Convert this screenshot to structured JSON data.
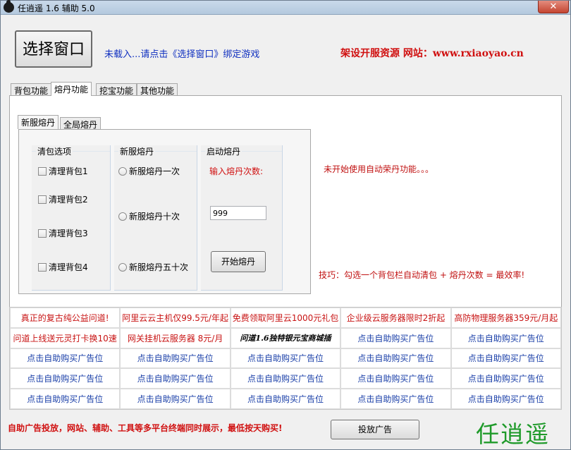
{
  "window": {
    "title": "任逍遥 1.6 辅助 5.0",
    "close_label": "✕"
  },
  "header": {
    "select_window_label": "选择窗口",
    "status_text": "未载入...请点击《选择窗口》绑定游戏",
    "site_text": "架设开服资源 网站：www.rxiaoyao.cn"
  },
  "tabs": [
    {
      "label": "背包功能"
    },
    {
      "label": "熔丹功能"
    },
    {
      "label": "挖宝功能"
    },
    {
      "label": "其他功能"
    }
  ],
  "sub_tabs": [
    {
      "label": "新服熔丹"
    },
    {
      "label": "全局熔丹"
    }
  ],
  "clean_bag": {
    "title": "清包选项",
    "items": [
      {
        "label": "清理背包1",
        "checked": false
      },
      {
        "label": "清理背包2",
        "checked": false
      },
      {
        "label": "清理背包3",
        "checked": false
      },
      {
        "label": "清理背包4",
        "checked": false
      }
    ]
  },
  "new_server_melt": {
    "title": "新服熔丹",
    "options": [
      {
        "label": "新服熔丹一次"
      },
      {
        "label": "新服熔丹十次"
      },
      {
        "label": "新服熔丹五十次"
      }
    ]
  },
  "start_melt": {
    "title": "启动熔丹",
    "count_label": "输入熔丹次数:",
    "count_value": "999",
    "start_button": "开始熔丹"
  },
  "notes": {
    "status": "未开始使用自动荣丹功能。。。",
    "tip": "技巧：勾选一个背包栏自动清包 + 熔丹次数 = 最效率!"
  },
  "ads": [
    {
      "text": "真正的复古纯公益问道!",
      "style": "red"
    },
    {
      "text": "阿里云云主机仅99.5元/年起",
      "style": "red"
    },
    {
      "text": "免费领取阿里云1000元礼包",
      "style": "red"
    },
    {
      "text": "企业级云服务器限时2折起",
      "style": "red"
    },
    {
      "text": "高防物理服务器359元/月起",
      "style": "red"
    },
    {
      "text": "问道上线送元灵打卡换10速",
      "style": "red"
    },
    {
      "text": "网关挂机云服务器 8元/月",
      "style": "red"
    },
    {
      "text": "问道1.6独特银元宝商城插",
      "style": "black-italic"
    },
    {
      "text": "点击自助购买广告位",
      "style": "blue"
    },
    {
      "text": "点击自助购买广告位",
      "style": "blue"
    },
    {
      "text": "点击自助购买广告位",
      "style": "blue"
    },
    {
      "text": "点击自助购买广告位",
      "style": "blue"
    },
    {
      "text": "点击自助购买广告位",
      "style": "blue"
    },
    {
      "text": "点击自助购买广告位",
      "style": "blue"
    },
    {
      "text": "点击自助购买广告位",
      "style": "blue"
    },
    {
      "text": "点击自助购买广告位",
      "style": "blue"
    },
    {
      "text": "点击自助购买广告位",
      "style": "blue"
    },
    {
      "text": "点击自助购买广告位",
      "style": "blue"
    },
    {
      "text": "点击自助购买广告位",
      "style": "blue"
    },
    {
      "text": "点击自助购买广告位",
      "style": "blue"
    },
    {
      "text": "点击自助购买广告位",
      "style": "blue"
    },
    {
      "text": "点击自助购买广告位",
      "style": "blue"
    },
    {
      "text": "点击自助购买广告位",
      "style": "blue"
    },
    {
      "text": "点击自助购买广告位",
      "style": "blue"
    },
    {
      "text": "点击自助购买广告位",
      "style": "blue"
    }
  ],
  "footer": {
    "note": "自助广告投放，网站、辅助、工具等多平台终端同时展示，最低按天购买!",
    "publish_button": "投放广告",
    "brand": "任逍遥"
  },
  "colors": {
    "accent_red": "#d01010",
    "link_blue": "#1a3fa8",
    "brand_green": "#1f9a2a"
  }
}
